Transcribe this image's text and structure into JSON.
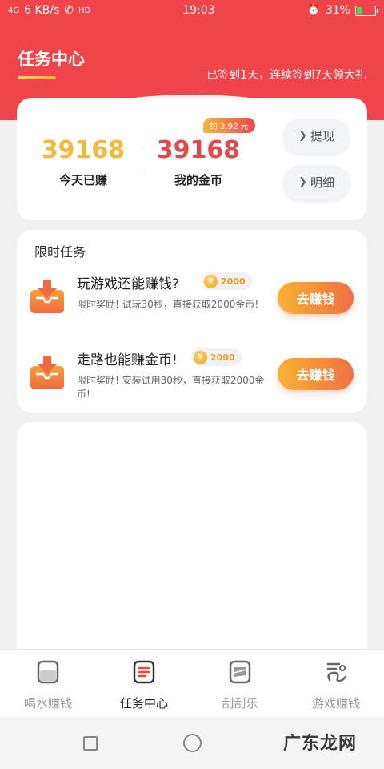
{
  "status_bar": {
    "signal": "4G",
    "speed": "6 KB/s",
    "call_indicator": "HD",
    "time": "19:03",
    "battery": "31%",
    "battery_level": 0.31
  },
  "header": {
    "title": "任务中心",
    "signin_text": "已签到1天，连续签到7天领大礼"
  },
  "coins": {
    "today_value": "39168",
    "today_label": "今天已赚",
    "mine_value": "39168",
    "mine_label": "我的金币",
    "rmb_badge": "约 3.92 元",
    "withdraw_label": "提现",
    "detail_label": "明细"
  },
  "limited_tasks": {
    "section_title": "限时任务",
    "tasks": [
      {
        "title": "玩游戏还能赚钱?",
        "coins": "2000",
        "desc": "限时奖励! 试玩30秒，直接获取2000金币!",
        "button": "去赚钱"
      },
      {
        "title": "走路也能赚金币!",
        "coins": "2000",
        "desc": "限时奖励! 安装试用30秒，直接获取2000金币!",
        "button": "去赚钱"
      }
    ]
  },
  "tab_bar": {
    "tabs": [
      {
        "label": "喝水赚钱",
        "icon": "cup-icon"
      },
      {
        "label": "任务中心",
        "icon": "task-list-icon",
        "active": true
      },
      {
        "label": "刮刮乐",
        "icon": "scratch-card-icon"
      },
      {
        "label": "游戏赚钱",
        "icon": "game-icon"
      }
    ]
  },
  "watermark": "广东龙网",
  "colors": {
    "brand_red": "#f0444b",
    "gold": "#f6b83a",
    "coin_red": "#e5484b",
    "button_gradient_start": "#f9b233",
    "button_gradient_end": "#f07045"
  }
}
